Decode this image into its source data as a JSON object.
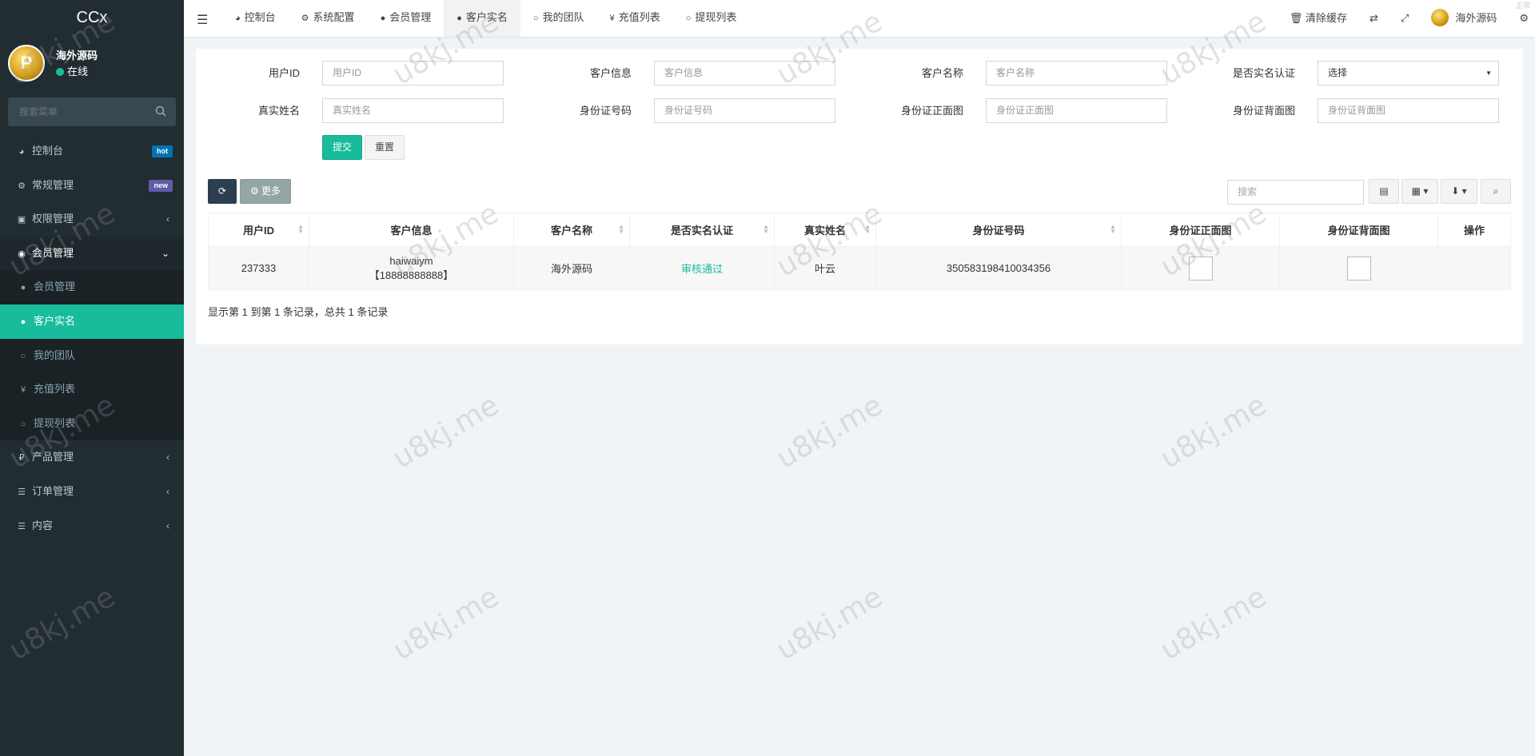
{
  "brand": "CCx",
  "user": {
    "name": "海外源码",
    "status": "在线",
    "avatar_letter": "P"
  },
  "sidebar": {
    "search_placeholder": "搜索菜单",
    "items": [
      {
        "label": "控制台",
        "icon": "dashboard-icon",
        "glyph": "◕",
        "badge": "hot",
        "badge_color": "#0073b7"
      },
      {
        "label": "常规管理",
        "icon": "cogs-icon",
        "glyph": "⚙",
        "badge": "new",
        "badge_color": "#605ca8"
      },
      {
        "label": "权限管理",
        "icon": "group-icon",
        "glyph": "👥",
        "chevron": "‹"
      },
      {
        "label": "会员管理",
        "icon": "user-circle-icon",
        "glyph": "◉",
        "chevron": "⌄"
      }
    ],
    "sub_items": [
      {
        "label": "会员管理",
        "glyph": "●"
      },
      {
        "label": "客户实名",
        "glyph": "●"
      },
      {
        "label": "我的团队",
        "glyph": "○"
      },
      {
        "label": "充值列表",
        "glyph": "¥"
      },
      {
        "label": "提现列表",
        "glyph": "○"
      }
    ],
    "more_items": [
      {
        "label": "产品管理",
        "glyph": "₽",
        "chevron": "‹"
      },
      {
        "label": "订单管理",
        "glyph": "☰",
        "chevron": "‹"
      },
      {
        "label": "内容",
        "glyph": "☰",
        "chevron": "‹"
      }
    ]
  },
  "topbar": {
    "tabs": [
      {
        "label": "控制台",
        "glyph": "◕"
      },
      {
        "label": "系统配置",
        "glyph": "⚙"
      },
      {
        "label": "会员管理",
        "glyph": "●"
      },
      {
        "label": "客户实名",
        "glyph": "●"
      },
      {
        "label": "我的团队",
        "glyph": "○"
      },
      {
        "label": "充值列表",
        "glyph": "¥"
      },
      {
        "label": "提现列表",
        "glyph": "○"
      }
    ],
    "clear_cache": "清除缓存",
    "user_name": "海外源码"
  },
  "filters": {
    "user_id_label": "用户ID",
    "user_id_placeholder": "用户ID",
    "customer_info_label": "客户信息",
    "customer_info_placeholder": "客户信息",
    "customer_name_label": "客户名称",
    "customer_name_placeholder": "客户名称",
    "verified_label": "是否实名认证",
    "verified_value": "选择",
    "real_name_label": "真实姓名",
    "real_name_placeholder": "真实姓名",
    "id_number_label": "身份证号码",
    "id_number_placeholder": "身份证号码",
    "id_front_label": "身份证正面图",
    "id_front_placeholder": "身份证正面图",
    "id_back_label": "身份证背面图",
    "id_back_placeholder": "身份证背面图",
    "submit": "提交",
    "reset": "重置"
  },
  "toolbar": {
    "more": "更多",
    "search_placeholder": "搜索"
  },
  "table": {
    "headers": [
      "用户ID",
      "客户信息",
      "客户名称",
      "是否实名认证",
      "真实姓名",
      "身份证号码",
      "身份证正面图",
      "身份证背面图",
      "操作"
    ],
    "rows": [
      {
        "user_id": "237333",
        "info_line1": "haiwaiym",
        "info_line2": "【18888888888】",
        "name": "海外源码",
        "verified": "审核通过",
        "real_name": "叶云",
        "id_number": "350583198410034356"
      }
    ],
    "footer": "显示第 1 到第 1 条记录，总共 1 条记录"
  },
  "watermark": "u8kj.me",
  "corner_text": "正常"
}
